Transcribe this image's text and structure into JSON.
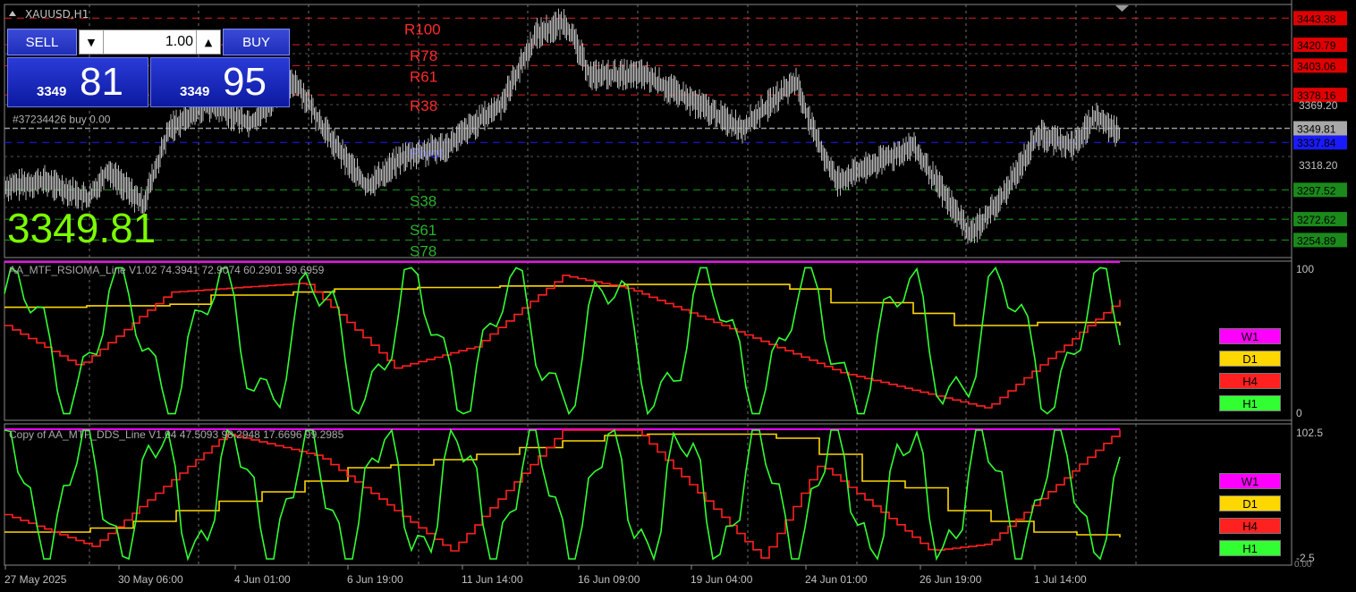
{
  "symbol": "XAUUSD,H1",
  "trade_panel": {
    "sell_label": "SELL",
    "buy_label": "BUY",
    "lot": "1.00",
    "bid_small": "3349",
    "bid_big": "81",
    "ask_small": "3349",
    "ask_big": "95"
  },
  "current_price_big": "3349.81",
  "order_label": "#37234426 buy 0.00",
  "levels": [
    {
      "name": "R100",
      "value": "3443.38",
      "kind": "resistance"
    },
    {
      "name": "R78",
      "value": "3420.79",
      "kind": "resistance"
    },
    {
      "name": "R61",
      "value": "3403.06",
      "kind": "resistance"
    },
    {
      "name": "R38",
      "value": "3378.16",
      "kind": "resistance"
    },
    {
      "name": "Pivot",
      "value": "3337.84",
      "kind": "pivot"
    },
    {
      "name": "S38",
      "value": "3297.52",
      "kind": "support"
    },
    {
      "name": "S61",
      "value": "3272.62",
      "kind": "support"
    },
    {
      "name": "S78",
      "value": "3254.89",
      "kind": "support"
    }
  ],
  "price_axis": {
    "ticks": [
      "3369.20",
      "3318.20"
    ],
    "current_tag": "3349.81"
  },
  "indicator1": {
    "label": "AA_MTF_RSIOMA_Line V1.02 74.3941 72.9074 60.2901 99.6959",
    "axis_top": "100",
    "axis_bottom": "0"
  },
  "indicator2": {
    "label": "Copy of AA_MTF_DDS_Line V1.04 47.5093 98.2948 17.6696 99.2985",
    "axis_top": "102.5",
    "axis_bottom": "-2.5",
    "axis_unit": "0.00"
  },
  "legend": [
    "W1",
    "D1",
    "H4",
    "H1"
  ],
  "time_axis": [
    "27 May 2025",
    "30 May 06:00",
    "4 Jun 01:00",
    "6 Jun 19:00",
    "11 Jun 14:00",
    "16 Jun 09:00",
    "19 Jun 04:00",
    "24 Jun 01:00",
    "26 Jun 19:00",
    "1 Jul 14:00"
  ],
  "colors": {
    "w1": "#ff00ff",
    "d1": "#ffd700",
    "h4": "#ff2020",
    "h1": "#32ff32",
    "resistance": "#e02020",
    "support": "#1aa01a",
    "pivot": "#1a1aff"
  }
}
